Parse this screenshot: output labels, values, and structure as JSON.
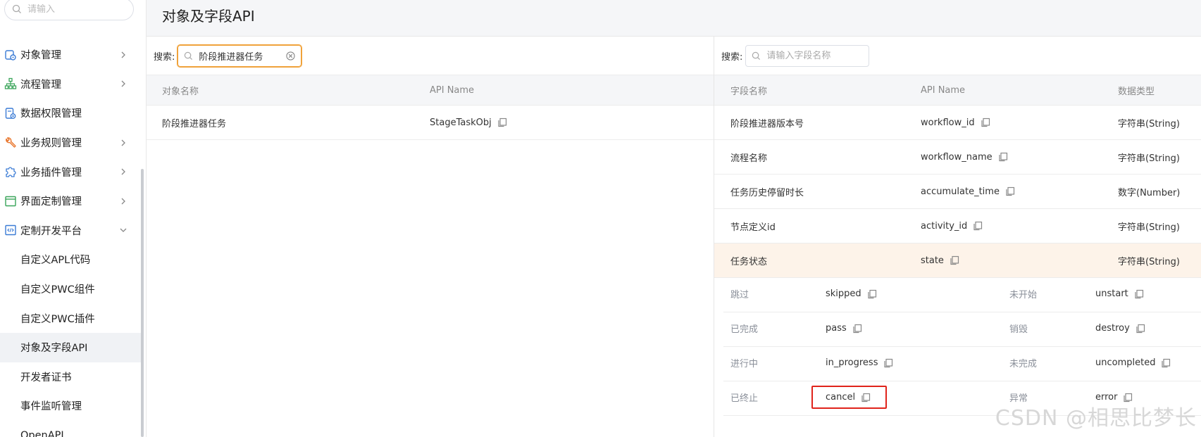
{
  "sidebar": {
    "search_placeholder": "请输入",
    "items": [
      {
        "label": "对象管理",
        "icon": "object-icon",
        "arrow": "right"
      },
      {
        "label": "流程管理",
        "icon": "flow-icon",
        "arrow": "right"
      },
      {
        "label": "数据权限管理",
        "icon": "data-permission-icon",
        "arrow": ""
      },
      {
        "label": "业务规则管理",
        "icon": "wrench-icon",
        "arrow": "right"
      },
      {
        "label": "业务插件管理",
        "icon": "puzzle-icon",
        "arrow": "right"
      },
      {
        "label": "界面定制管理",
        "icon": "window-icon",
        "arrow": "right"
      },
      {
        "label": "定制开发平台",
        "icon": "code-icon",
        "arrow": "down"
      }
    ],
    "sub_items": [
      "自定义APL代码",
      "自定义PWC组件",
      "自定义PWC插件",
      "对象及字段API",
      "开发者证书",
      "事件监听管理",
      "OpenAPI"
    ],
    "active_sub": "对象及字段API"
  },
  "header": {
    "title": "对象及字段API"
  },
  "left": {
    "search_label": "搜索:",
    "search_value": "阶段推进器任务",
    "columns": [
      "对象名称",
      "API Name"
    ],
    "rows": [
      {
        "name": "阶段推进器任务",
        "api": "StageTaskObj"
      }
    ]
  },
  "right": {
    "search_label": "搜索:",
    "search_placeholder": "请输入字段名称",
    "columns": [
      "字段名称",
      "API Name",
      "数据类型"
    ],
    "rows": [
      {
        "name": "阶段推进器版本号",
        "api": "workflow_id",
        "type": "字符串(String)"
      },
      {
        "name": "流程名称",
        "api": "workflow_name",
        "type": "字符串(String)"
      },
      {
        "name": "任务历史停留时长",
        "api": "accumulate_time",
        "type": "数字(Number)"
      },
      {
        "name": "节点定义id",
        "api": "activity_id",
        "type": "字符串(String)"
      },
      {
        "name": "任务状态",
        "api": "state",
        "type": "字符串(String)"
      }
    ],
    "enum_options": [
      {
        "l1": "跳过",
        "v1": "skipped",
        "l2": "未开始",
        "v2": "unstart"
      },
      {
        "l1": "已完成",
        "v1": "pass",
        "l2": "销毁",
        "v2": "destroy"
      },
      {
        "l1": "进行中",
        "v1": "in_progress",
        "l2": "未完成",
        "v2": "uncompleted"
      },
      {
        "l1": "已终止",
        "v1": "cancel",
        "l2": "异常",
        "v2": "error"
      }
    ]
  },
  "watermark": "CSDN @相思比梦长",
  "colors": {
    "accent_orange": "#f0a23a",
    "highlight_row": "#fdf3e9",
    "red_box": "#e0231b"
  }
}
